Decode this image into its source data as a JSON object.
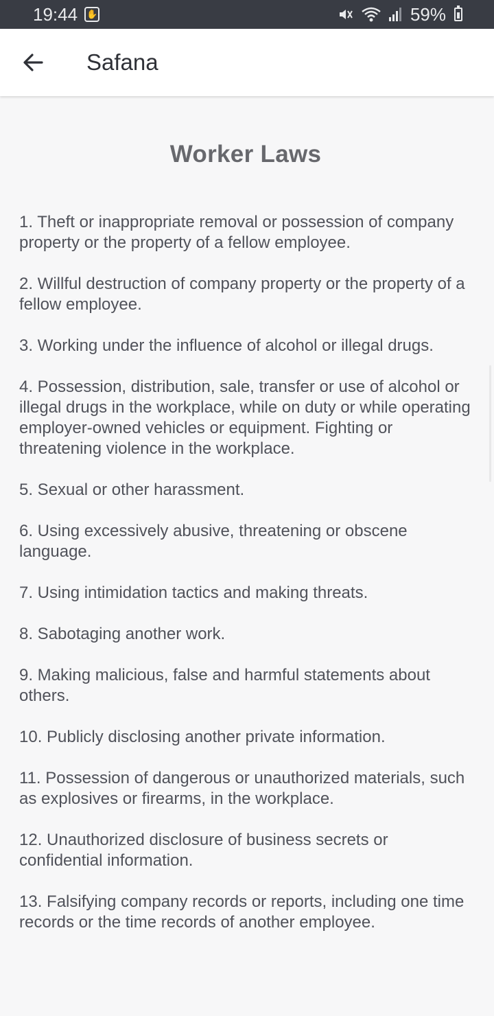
{
  "status_bar": {
    "time": "19:44",
    "battery": "59%",
    "icons": [
      "hand-notification-icon",
      "mute-icon",
      "wifi-icon",
      "signal-icon",
      "battery-charging-icon"
    ]
  },
  "app_bar": {
    "title": "Safana",
    "back_icon": "arrow-left-icon"
  },
  "page": {
    "heading": "Worker Laws",
    "laws": [
      "1. Theft or inappropriate removal or possession of company property or the property of a fellow employee.",
      " 2. Willful destruction of company property or the property of a fellow employee.",
      " 3. Working under the influence of alcohol or illegal drugs.",
      " 4. Possession, distribution, sale, transfer or use of alcohol or illegal drugs in the workplace, while on duty or while operating employer-owned vehicles or equipment. Fighting or threatening violence in the workplace.",
      " 5. Sexual or other harassment.",
      " 6. Using excessively abusive, threatening or obscene language.",
      " 7. Using intimidation tactics and making threats.",
      " 8. Sabotaging another work.",
      " 9. Making malicious, false and harmful statements about others.",
      " 10. Publicly disclosing another private information.",
      " 11. Possession of dangerous or unauthorized materials, such as explosives or firearms, in the workplace.",
      " 12. Unauthorized disclosure of business secrets or confidential information.",
      " 13. Falsifying company records or reports, including one time records or the time records of another employee."
    ]
  },
  "colors": {
    "status_bar_bg": "#393c44",
    "app_bar_bg": "#ffffff",
    "page_bg": "#f7f7f8",
    "heading": "#67686d",
    "body_text": "#50525a"
  }
}
